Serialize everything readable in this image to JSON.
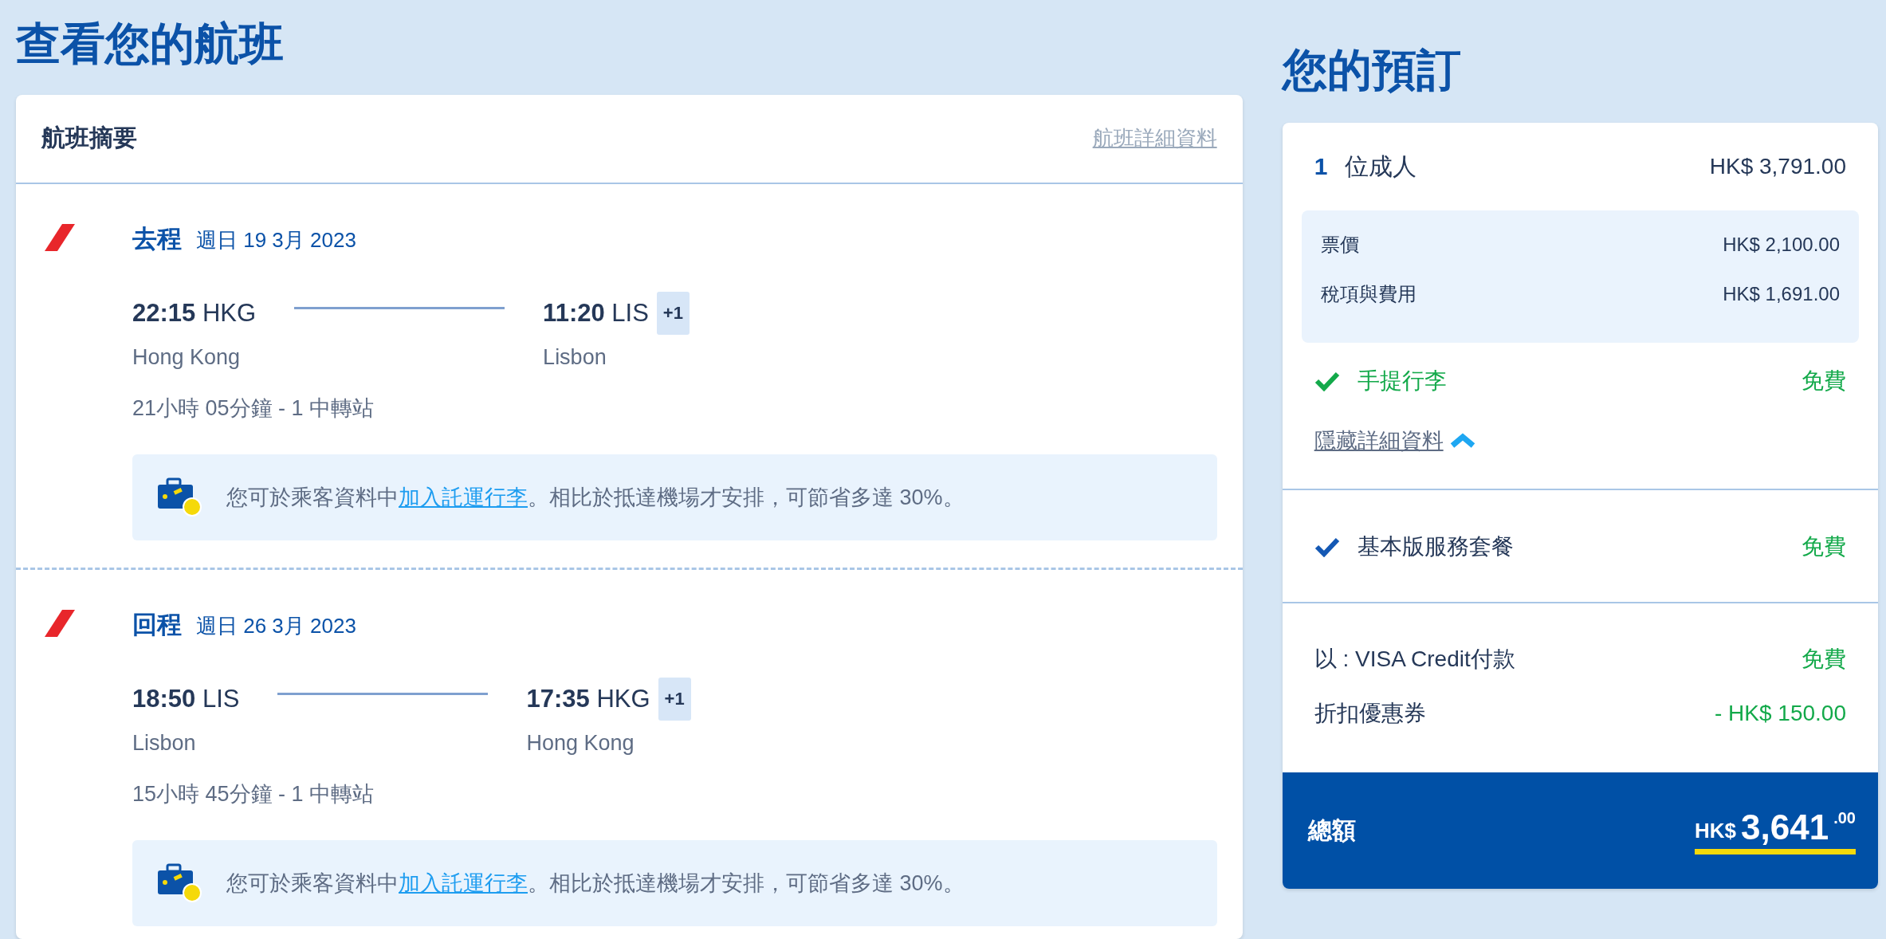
{
  "page_title": "查看您的航班",
  "flight_summary": {
    "title": "航班摘要",
    "details_link": "航班詳細資料",
    "legs": [
      {
        "direction": "去程",
        "date": "週日 19 3月 2023",
        "depart_time": "22:15",
        "depart_code": "HKG",
        "depart_city": "Hong Kong",
        "arrive_time": "11:20",
        "arrive_code": "LIS",
        "arrive_city": "Lisbon",
        "day_offset": "+1",
        "duration": "21小時 05分鐘 - 1 中轉站",
        "tip_before": "您可於乘客資料中",
        "tip_link": "加入託運行李",
        "tip_after": "。相比於抵達機場才安排，可節省多達 30%。"
      },
      {
        "direction": "回程",
        "date": "週日 26 3月 2023",
        "depart_time": "18:50",
        "depart_code": "LIS",
        "depart_city": "Lisbon",
        "arrive_time": "17:35",
        "arrive_code": "HKG",
        "arrive_city": "Hong Kong",
        "day_offset": "+1",
        "duration": "15小時 45分鐘 - 1 中轉站",
        "tip_before": "您可於乘客資料中",
        "tip_link": "加入託運行李",
        "tip_after": "。相比於抵達機場才安排，可節省多達 30%。"
      }
    ]
  },
  "booking": {
    "title": "您的預訂",
    "passengers": {
      "count": "1",
      "label": "位成人",
      "amount": "HK$ 3,791.00"
    },
    "breakdown": [
      {
        "label": "票價",
        "amount": "HK$ 2,100.00"
      },
      {
        "label": "稅項與費用",
        "amount": "HK$ 1,691.00"
      }
    ],
    "extras": [
      {
        "kind": "baggage",
        "label": "手提行李",
        "price": "免費",
        "toggle_link": "隱藏詳細資料",
        "expanded": true
      },
      {
        "kind": "package",
        "label": "基本版服務套餐",
        "price": "免費"
      }
    ],
    "payment": [
      {
        "label": "以 : VISA Credit付款",
        "amount": "免費"
      },
      {
        "label": "折扣優惠券",
        "amount": "- HK$ 150.00"
      }
    ],
    "total": {
      "label": "總額",
      "currency": "HK$",
      "integer": "3,641",
      "decimals": ".00"
    }
  }
}
